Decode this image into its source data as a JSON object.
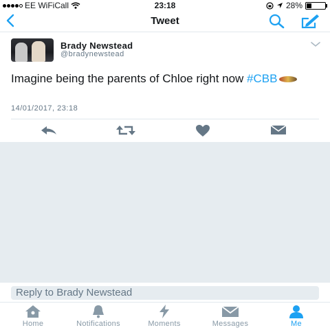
{
  "status_bar": {
    "carrier": "EE WiFiCall",
    "time": "23:18",
    "battery": "28%",
    "battery_level": 0.28,
    "signal_bars_filled": 4,
    "signal_bars_total": 5
  },
  "navbar": {
    "title": "Tweet",
    "back_icon": "chevron-left-icon",
    "search_icon": "search-icon",
    "compose_icon": "compose-icon"
  },
  "tweet": {
    "author_name": "Brady Newstead",
    "author_handle": "@bradynewstead",
    "text_before": "Imagine being the parents of Chloe right now ",
    "hashtag": "#CBB",
    "timestamp": "14/01/2017, 23:18",
    "actions": [
      "reply-icon",
      "retweet-icon",
      "like-icon",
      "direct-message-icon"
    ]
  },
  "reply": {
    "placeholder": "Reply to Brady Newstead"
  },
  "tabbar": {
    "home": "Home",
    "notifications": "Notifications",
    "moments": "Moments",
    "messages": "Messages",
    "me": "Me"
  },
  "colors": {
    "accent": "#1da1f2",
    "text": "#14171a",
    "muted": "#657786",
    "background_gray": "#e6ecf0"
  }
}
